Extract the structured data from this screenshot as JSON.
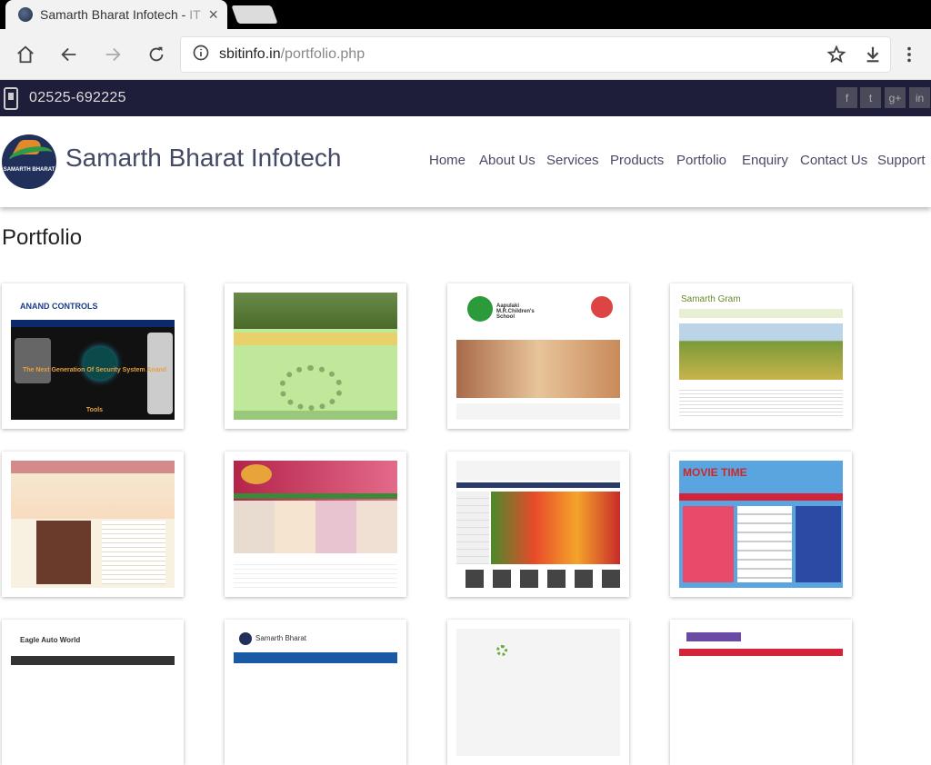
{
  "browser": {
    "tab_title": "Samarth Bharat Infotech - ",
    "tab_title_fade": "IT",
    "url_domain": "sbitinfo.in",
    "url_path": "/portfolio.php"
  },
  "topbar": {
    "phone": "02525-692225",
    "social": [
      "f",
      "t",
      "g+",
      "in"
    ]
  },
  "site": {
    "brand": "Samarth Bharat Infotech",
    "logo_text": "SAMARTH BHARAT",
    "nav": [
      "Home",
      "About Us",
      "Services",
      "Products",
      "Portfolio",
      "Enquiry",
      "Contact Us",
      "Support"
    ]
  },
  "page": {
    "heading": "Portfolio"
  },
  "portfolio": [
    {
      "label": "ANAND CONTROLS",
      "caption": "The Next Generation Of Security System Anand Tools"
    },
    {
      "label": "",
      "caption": ""
    },
    {
      "label": "Aapulaki M.R.Children's School",
      "caption": ""
    },
    {
      "label": "Samarth Gram",
      "caption": ""
    },
    {
      "label": "",
      "caption": ""
    },
    {
      "label": "",
      "caption": ""
    },
    {
      "label": "",
      "caption": ""
    },
    {
      "label": "MOVIE TIME",
      "caption": ""
    },
    {
      "label": "Eagle Auto World",
      "caption": ""
    },
    {
      "label": "Samarth Bharat",
      "caption": ""
    },
    {
      "label": "",
      "caption": ""
    },
    {
      "label": "",
      "caption": ""
    }
  ]
}
